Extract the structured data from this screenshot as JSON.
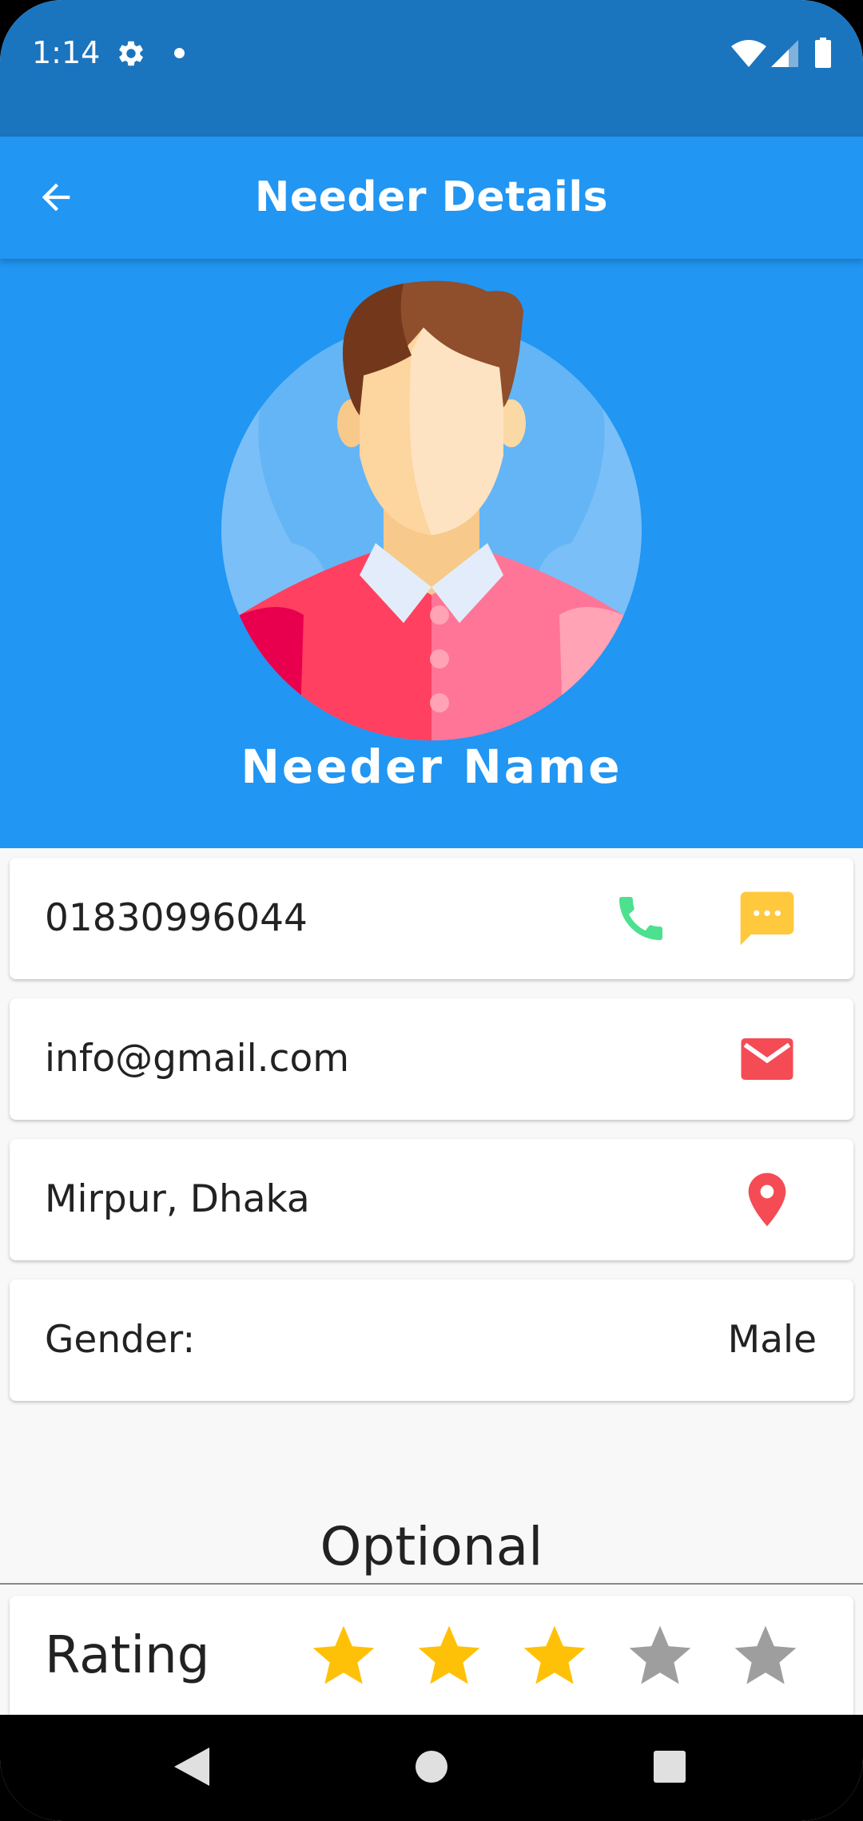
{
  "status_bar": {
    "time": "1:14",
    "settings_icon": "gear-icon",
    "wifi_icon": "wifi-icon",
    "signal_icon": "signal-icon",
    "battery_icon": "battery-icon"
  },
  "app_bar": {
    "title": "Needer Details",
    "back_icon": "arrow-back-icon"
  },
  "profile": {
    "name": "Needer Name",
    "avatar_icon": "male-avatar-illustration"
  },
  "contact": {
    "phone": "01830996044",
    "email": "info@gmail.com",
    "address": "Mirpur, Dhaka",
    "gender_label": "Gender:",
    "gender_value": "Male"
  },
  "optional": {
    "title": "Optional",
    "rating_label": "Rating",
    "rating_value": 3,
    "rating_max": 5
  },
  "colors": {
    "status_bar": "#1B74BE",
    "primary": "#2196F3",
    "phone_icon": "#4CE08F",
    "message_icon": "#FFC83D",
    "email_icon": "#F44B55",
    "location_icon": "#F44B55",
    "star_filled": "#FFC107",
    "star_empty": "#9E9E9E"
  }
}
